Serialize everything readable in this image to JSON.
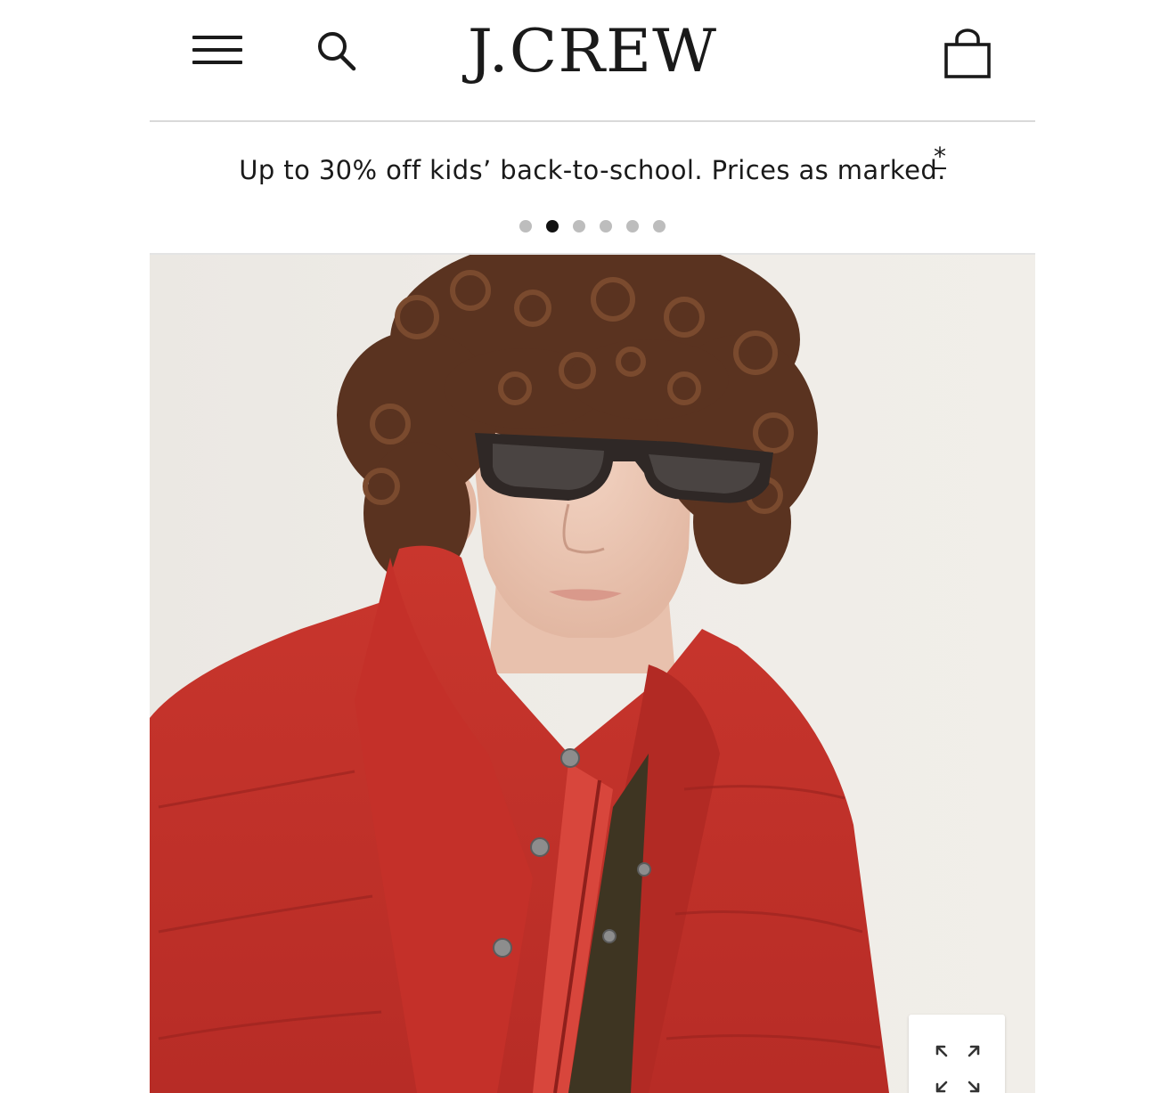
{
  "header": {
    "logo": "J.CREW",
    "icons": {
      "menu": "hamburger-menu-icon",
      "search": "search-icon",
      "bag": "shopping-bag-icon"
    }
  },
  "promo": {
    "text": "Up to 30% off kids’ back-to-school. Prices as marked.",
    "disclaimer_marker": "*",
    "carousel": {
      "total": 6,
      "active_index": 1
    }
  },
  "hero": {
    "icons": {
      "expand": "expand-arrows-icon"
    },
    "colors": {
      "jacket": "#c3322b",
      "hair": "#5a3320",
      "background": "#ece9e4"
    }
  }
}
